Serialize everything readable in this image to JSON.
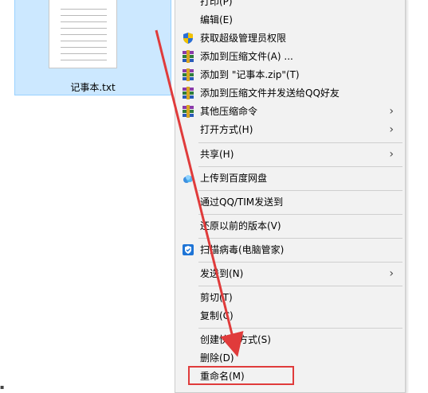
{
  "file": {
    "name": "记事本.txt"
  },
  "menu": {
    "items": [
      {
        "label": "打印(P)",
        "icon": null,
        "submenu": false
      },
      {
        "label": "编辑(E)",
        "icon": null,
        "submenu": false
      },
      {
        "label": "获取超级管理员权限",
        "icon": "shield-icon",
        "submenu": false
      },
      {
        "label": "添加到压缩文件(A) ...",
        "icon": "winrar-icon",
        "submenu": false
      },
      {
        "label": "添加到 \"记事本.zip\"(T)",
        "icon": "winrar-icon",
        "submenu": false
      },
      {
        "label": "添加到压缩文件并发送给QQ好友",
        "icon": "winrar-icon",
        "submenu": false
      },
      {
        "label": "其他压缩命令",
        "icon": "winrar-icon",
        "submenu": true
      },
      {
        "label": "打开方式(H)",
        "icon": null,
        "submenu": true
      },
      {
        "label": "共享(H)",
        "icon": null,
        "submenu": true
      },
      {
        "label": "上传到百度网盘",
        "icon": "baidu-cloud-icon",
        "submenu": false
      },
      {
        "label": "通过QQ/TIM发送到",
        "icon": null,
        "submenu": false
      },
      {
        "label": "还原以前的版本(V)",
        "icon": null,
        "submenu": false
      },
      {
        "label": "扫描病毒(电脑管家)",
        "icon": "tencent-guard-icon",
        "submenu": false
      },
      {
        "label": "发送到(N)",
        "icon": null,
        "submenu": true
      },
      {
        "label": "剪切(T)",
        "icon": null,
        "submenu": false
      },
      {
        "label": "复制(C)",
        "icon": null,
        "submenu": false
      },
      {
        "label": "创建快捷方式(S)",
        "icon": null,
        "submenu": false
      },
      {
        "label": "删除(D)",
        "icon": null,
        "submenu": false
      },
      {
        "label": "重命名(M)",
        "icon": null,
        "submenu": false
      }
    ]
  },
  "annotation": {
    "color": "#e03b3b",
    "highlighted_item": "重命名(M)"
  },
  "colors": {
    "selection": "#cce8ff",
    "menu_bg": "#f2f2f2",
    "winrar": "#8b3aa8",
    "shield_blue": "#2a6fd6",
    "shield_yellow": "#f2c200"
  }
}
